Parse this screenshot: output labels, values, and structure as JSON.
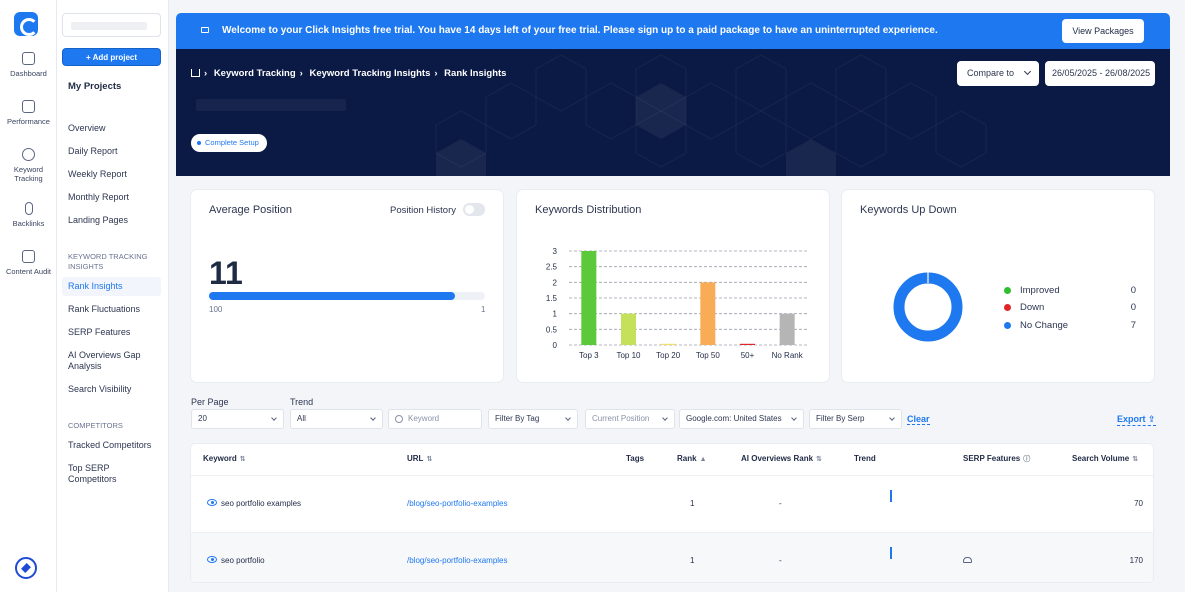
{
  "rail": {
    "items": [
      {
        "label": "Dashboard",
        "icon": "dashboard-icon"
      },
      {
        "label": "Performance",
        "icon": "performance-icon"
      },
      {
        "label": "Keyword Tracking",
        "icon": "keyword-tracking-icon"
      },
      {
        "label": "Backlinks",
        "icon": "backlinks-icon"
      },
      {
        "label": "Content Audit",
        "icon": "content-audit-icon"
      }
    ]
  },
  "sidebar": {
    "add_project": "+ Add project",
    "my_projects": "My Projects",
    "links": [
      "Overview",
      "Daily Report",
      "Weekly Report",
      "Monthly Report",
      "Landing Pages"
    ],
    "section_kt": "KEYWORD TRACKING INSIGHTS",
    "kt_links": [
      "Rank Insights",
      "Rank Fluctuations",
      "SERP Features",
      "AI Overviews Gap Analysis",
      "Search Visibility"
    ],
    "section_comp": "COMPETITORS",
    "comp_links": [
      "Tracked Competitors",
      "Top SERP Competitors"
    ]
  },
  "banner": {
    "message": "Welcome to your Click Insights free trial. You have 14 days left of your free trial. Please sign up to a paid package to have an uninterrupted experience.",
    "button": "View Packages"
  },
  "hero": {
    "crumbs": [
      "Keyword Tracking",
      "Keyword Tracking Insights",
      "Rank Insights"
    ],
    "compare": "Compare to",
    "date_range": "26/05/2025 - 26/08/2025",
    "setup": "Complete Setup"
  },
  "avg_position": {
    "title": "Average Position",
    "toggle_label": "Position History",
    "value": "11",
    "progress_fraction": 0.89,
    "min_label": "100",
    "max_label": "1"
  },
  "distribution": {
    "title": "Keywords Distribution"
  },
  "updown": {
    "title": "Keywords Up Down",
    "items": [
      {
        "label": "Improved",
        "value": "0",
        "color": "#2fbf2f"
      },
      {
        "label": "Down",
        "value": "0",
        "color": "#e0262a"
      },
      {
        "label": "No Change",
        "value": "7",
        "color": "#1e78f0"
      }
    ]
  },
  "filters": {
    "per_page_label": "Per Page",
    "per_page_value": "20",
    "trend_label": "Trend",
    "trend_value": "All",
    "keyword_placeholder": "Keyword",
    "tag": "Filter By Tag",
    "position": "Current Position",
    "engine": "Google.com: United States",
    "serp": "Filter By Serp",
    "clear": "Clear",
    "export": "Export"
  },
  "table": {
    "headers": [
      "Keyword",
      "URL",
      "Tags",
      "Rank",
      "AI Overviews Rank",
      "Trend",
      "SERP Features",
      "Search Volume"
    ],
    "rows": [
      {
        "keyword": "seo portfolio examples",
        "url": "/blog/seo-portfolio-examples",
        "tags": "",
        "rank": "1",
        "ai_rank": "-",
        "volume": "70"
      },
      {
        "keyword": "seo portfolio",
        "url": "/blog/seo-portfolio-examples",
        "tags": "",
        "rank": "1",
        "ai_rank": "-",
        "volume": "170"
      }
    ]
  },
  "chart_data": {
    "type": "bar",
    "categories": [
      "Top 3",
      "Top 10",
      "Top 20",
      "Top 50",
      "50+",
      "No Rank"
    ],
    "values": [
      3,
      1,
      0,
      2,
      0,
      1
    ],
    "colors": [
      "#5cc93a",
      "#c5e15c",
      "#f5dd6a",
      "#f7ac55",
      "#e0262a",
      "#b5b5b5"
    ],
    "yticks": [
      "0",
      "0.5",
      "1",
      "1.5",
      "2",
      "2.5",
      "3"
    ],
    "ylim": [
      0,
      3
    ],
    "grid": true
  }
}
